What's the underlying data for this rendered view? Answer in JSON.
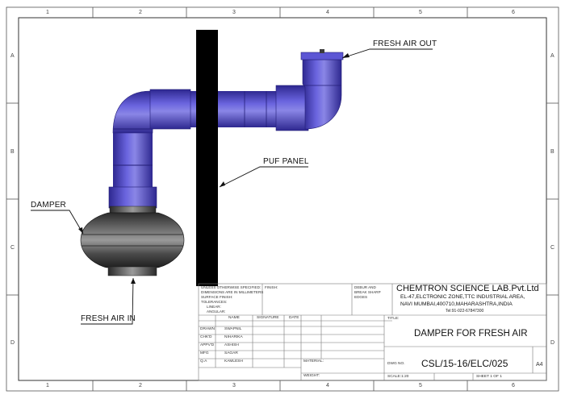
{
  "border": {
    "top_numbers": [
      "1",
      "2",
      "3",
      "4",
      "5",
      "6"
    ],
    "bottom_numbers": [
      "1",
      "2",
      "3",
      "4",
      "5",
      "6"
    ],
    "left_letters": [
      "A",
      "B",
      "C",
      "D"
    ],
    "right_letters": [
      "A",
      "B",
      "C",
      "D"
    ]
  },
  "callouts": {
    "fresh_air_out": "FRESH AIR OUT",
    "puf_panel": "PUF PANEL",
    "damper": "DAMPER",
    "fresh_air_in": "FRESH AIR IN"
  },
  "colors": {
    "pipe": "#4c44c8",
    "pipe_dark": "#2e2890",
    "pipe_light": "#8a86e6",
    "damper": "#3a3a3a",
    "damper_light": "#8a8a8a",
    "panel": "#000000"
  },
  "title_block": {
    "notes_lines": [
      "UNLESS OTHERWISE SPECIFIED:",
      "DIMENSIONS ARE IN MILLIMETERS",
      "SURFACE FINISH:",
      "TOLERANCES:",
      "LINEAR:",
      "ANGULAR:"
    ],
    "finish_label": "FINISH:",
    "deburr_lines": [
      "DEBUR AND",
      "BREAK SHARP",
      "EDGES"
    ],
    "company": "CHEMTRON SCIENCE LAB.Pvt.Ltd",
    "address_line1": "EL-47,ELCTRONIC ZONE,TTC INDUSTRIAL AREA,",
    "address_line2": "NAVI MUMBAI,400710,MAHARASHTRA,INDIA",
    "tel": "Tel:91-022-67847300",
    "headers": {
      "name": "NAME",
      "signature": "SIGNATURE",
      "date": "DATE"
    },
    "rows": [
      {
        "role": "DRAWN",
        "name": "SWAPNIL"
      },
      {
        "role": "CHK'D",
        "name": "NIHARIKA"
      },
      {
        "role": "APPV'D",
        "name": "ASHISH"
      },
      {
        "role": "MFG",
        "name": "SAGAR"
      },
      {
        "role": "Q.A",
        "name": "KAMLESH"
      }
    ],
    "material_label": "MATERIAL:",
    "weight_label": "WEIGHT:",
    "title_label": "TITLE:",
    "title": "DAMPER FOR FRESH AIR",
    "dwg_no_label": "DWG NO.",
    "dwg_no": "CSL/15-16/ELC/025",
    "size": "A4",
    "scale": "SCALE:1:20",
    "sheet": "SHEET 1 OF 1"
  }
}
